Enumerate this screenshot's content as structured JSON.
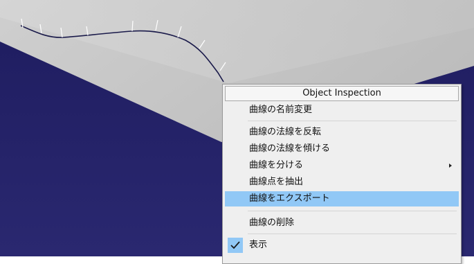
{
  "viewport": {
    "background_color": "#1f1d63",
    "surface_color": "#c8c8c8",
    "curve_color": "#1a1a4a",
    "normal_color": "#ffffff"
  },
  "context_menu": {
    "title": "Object Inspection",
    "items": [
      {
        "label": "曲線の名前変更"
      },
      {
        "label": "曲線の法線を反転"
      },
      {
        "label": "曲線の法線を傾ける"
      },
      {
        "label": "曲線を分ける",
        "has_submenu": true
      },
      {
        "label": "曲線点を抽出"
      },
      {
        "label": "曲線をエクスポート",
        "highlighted": true
      },
      {
        "label": "曲線の削除"
      },
      {
        "label": "表示",
        "checked": true
      }
    ],
    "highlight_color": "#91c8f6",
    "check_icon": "checkmark-icon",
    "submenu_icon": "submenu-arrow-icon"
  }
}
